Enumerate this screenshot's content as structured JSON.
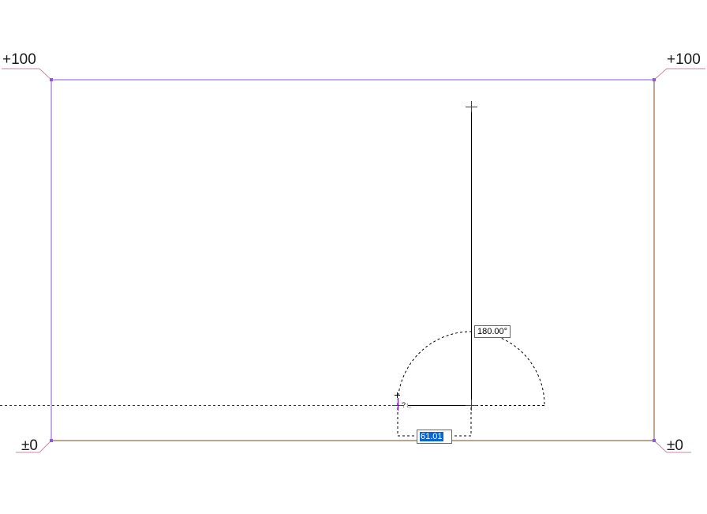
{
  "levels": {
    "top_left": "+100",
    "top_right": "+100",
    "bottom_left": "±0",
    "bottom_right": "±0"
  },
  "angle_input": {
    "value": "180.00°"
  },
  "length_input": {
    "value": "61.01"
  },
  "colors": {
    "top_edge": "#8a5ad8",
    "left_edge": "#8a5ad8",
    "right_edge": "#7a4a1e",
    "bottom_edge": "#7a4a1e",
    "leader": "#c88aa8",
    "snap": "#7a00e0",
    "selection": "#0a64d2"
  }
}
